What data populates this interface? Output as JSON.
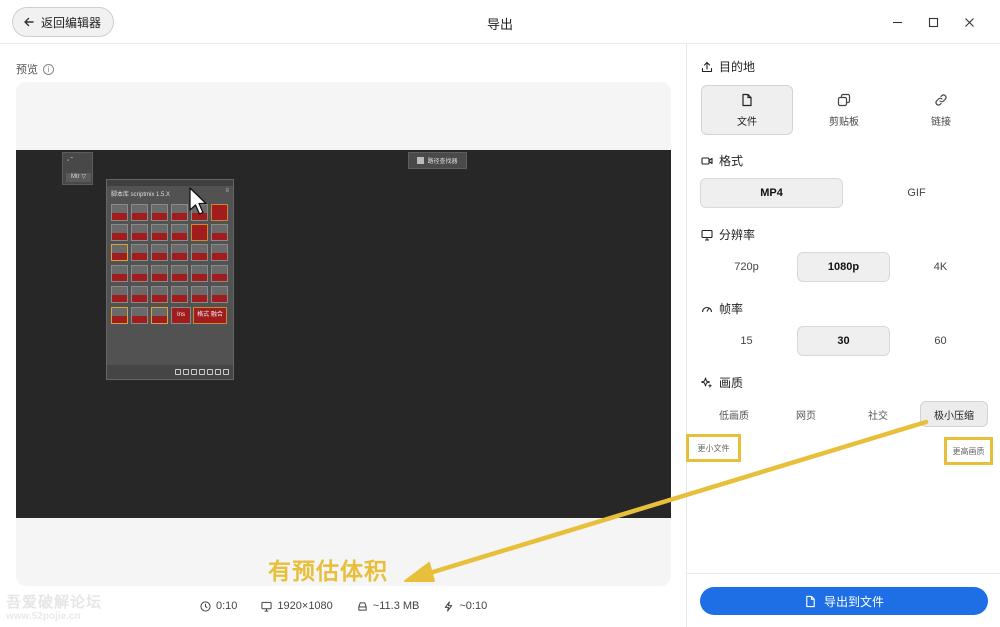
{
  "window": {
    "title": "导出",
    "back_label": "返回编辑器"
  },
  "preview": {
    "label": "预览",
    "info_glyph": "i",
    "inner": {
      "mini_label_top": "▫ ˜",
      "mini_label_bottom": "Mtr ▽",
      "path_button": "路径查找器",
      "panel_title": "脚本库 scriptmix 1.5.X",
      "panel_menu": "≡",
      "cell_labels": [
        "Ins",
        "格式 融合"
      ]
    }
  },
  "stats": {
    "duration": "0:10",
    "resolution": "1920×1080",
    "size": "~11.3 MB",
    "time": "~0:10"
  },
  "watermark": {
    "line1": "吾爱破解论坛",
    "line2": "www.52pojie.cn"
  },
  "destination": {
    "heading": "目的地",
    "options": [
      {
        "label": "文件",
        "icon": "file-icon",
        "active": true
      },
      {
        "label": "剪贴板",
        "icon": "clipboard-icon",
        "active": false
      },
      {
        "label": "链接",
        "icon": "link-icon",
        "active": false
      }
    ]
  },
  "format": {
    "heading": "格式",
    "options": [
      {
        "label": "MP4",
        "active": true
      },
      {
        "label": "GIF",
        "active": false
      }
    ]
  },
  "resolution": {
    "heading": "分辨率",
    "options": [
      {
        "label": "720p",
        "active": false
      },
      {
        "label": "1080p",
        "active": true
      },
      {
        "label": "4K",
        "active": false
      }
    ]
  },
  "framerate": {
    "heading": "帧率",
    "options": [
      {
        "label": "15",
        "active": false
      },
      {
        "label": "30",
        "active": true
      },
      {
        "label": "60",
        "active": false
      }
    ]
  },
  "quality": {
    "heading": "画质",
    "options": [
      {
        "label": "低画质",
        "active": false
      },
      {
        "label": "网页",
        "active": false
      },
      {
        "label": "社交",
        "active": false
      },
      {
        "label": "极小压缩",
        "active": true
      }
    ],
    "hint_left": "更小文件",
    "hint_right": "更高画质"
  },
  "export": {
    "label": "导出到文件"
  },
  "annotation": {
    "text": "有预估体积",
    "color": "#e8bf3a"
  },
  "colors": {
    "accent": "#1e6fe6",
    "annotation": "#e8bf3a",
    "video_bg": "#272727"
  }
}
